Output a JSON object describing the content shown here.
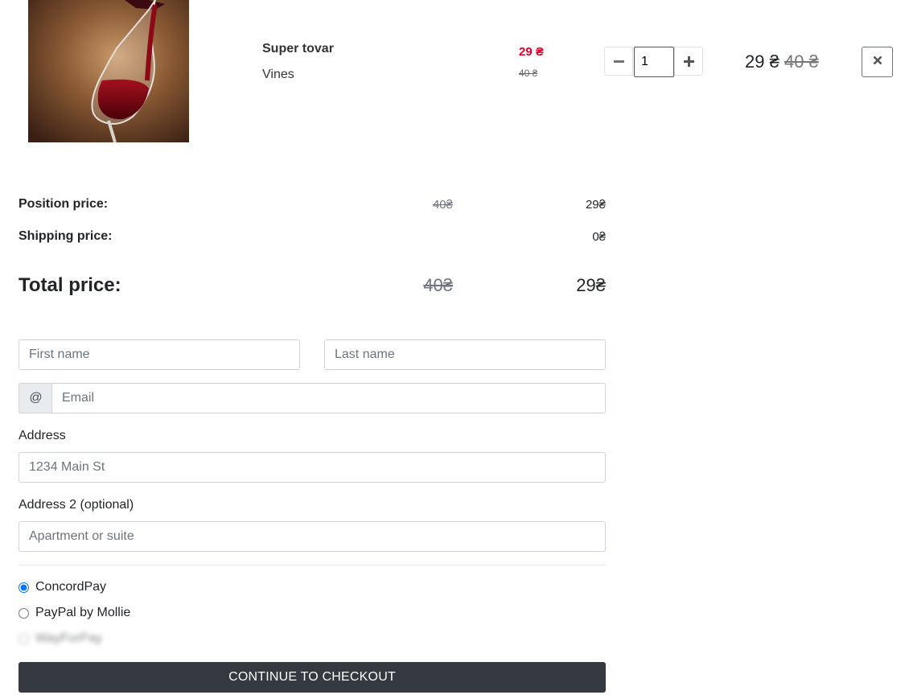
{
  "product": {
    "name": "Super tovar",
    "category": "Vines",
    "price": "29 ₴",
    "old_price": "40 ₴",
    "quantity": "1",
    "minus_icon": "minus-icon",
    "plus_icon": "plus-icon",
    "line_total": "29 ₴",
    "line_total_old": "40 ₴",
    "remove_icon": "close-icon"
  },
  "summary": {
    "position_label": "Position price:",
    "position_old": "40₴",
    "position_new": "29₴",
    "shipping_label": "Shipping price:",
    "shipping_value": "0₴",
    "total_label": "Total price:",
    "total_old": "40₴",
    "total_new": "29₴"
  },
  "form": {
    "first_name_placeholder": "First name",
    "last_name_placeholder": "Last name",
    "email_addon": "@",
    "email_placeholder": "Email",
    "address_label": "Address",
    "address_placeholder": "1234 Main St",
    "address2_label": "Address 2 (optional)",
    "address2_placeholder": "Apartment or suite"
  },
  "payment": {
    "options": [
      {
        "label": "ConcordPay",
        "selected": true
      },
      {
        "label": "PayPal by Mollie",
        "selected": false
      },
      {
        "label": "WayForPay",
        "selected": false
      }
    ]
  },
  "checkout_label": "CONTINUE TO CHECKOUT",
  "colors": {
    "sale_price": "#e0002a",
    "checkout_button": "#343a40"
  }
}
